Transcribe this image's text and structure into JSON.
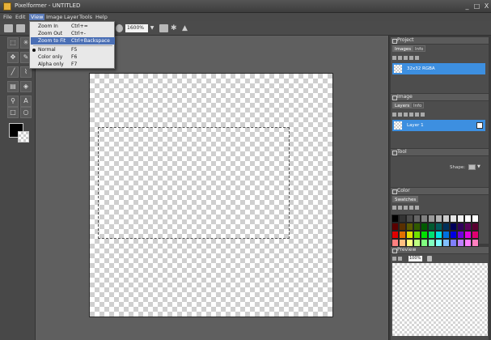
{
  "window": {
    "title": "Pixelformer - UNTITLED",
    "buttons": [
      "_",
      "□",
      "X"
    ]
  },
  "menubar": {
    "items": [
      "File",
      "Edit",
      "View",
      "Image",
      "Layer",
      "Tools",
      "Help"
    ],
    "open": "View"
  },
  "view_menu": {
    "items": [
      {
        "label": "Zoom In",
        "shortcut": "Ctrl+="
      },
      {
        "label": "Zoom Out",
        "shortcut": "Ctrl+-"
      },
      {
        "label": "Zoom to Fit",
        "shortcut": "Ctrl+Backspace",
        "highlighted": true
      },
      {
        "label": "Normal",
        "shortcut": "F5",
        "selected": true
      },
      {
        "label": "Color only",
        "shortcut": "F6"
      },
      {
        "label": "Alpha only",
        "shortcut": "F7"
      }
    ]
  },
  "toolbar": {
    "zoom_value": "1600%"
  },
  "panels": {
    "project": {
      "title": "Project",
      "tabs": [
        "Images",
        "Info"
      ],
      "item": "32x32 RGBA"
    },
    "image": {
      "title": "Image",
      "tabs": [
        "Layers",
        "Info"
      ],
      "item": "Layer 1"
    },
    "tool": {
      "title": "Tool",
      "shape_label": "Shape:"
    },
    "color": {
      "title": "Color",
      "tabs": [
        "Swatches"
      ],
      "swatches": [
        "#000000",
        "#333333",
        "#4d4d4d",
        "#666666",
        "#808080",
        "#999999",
        "#b3b3b3",
        "#cccccc",
        "#e6e6e6",
        "#f2f2f2",
        "#ffffff",
        "#ffffff",
        "#5a0000",
        "#5a3000",
        "#5a5a00",
        "#305a00",
        "#005a00",
        "#005a30",
        "#005a5a",
        "#00305a",
        "#00005a",
        "#30005a",
        "#5a005a",
        "#5a0030",
        "#e00000",
        "#e07000",
        "#e0e000",
        "#70e000",
        "#00e000",
        "#00e070",
        "#00e0e0",
        "#0070e0",
        "#0000e0",
        "#7000e0",
        "#e000e0",
        "#e00070",
        "#ff8080",
        "#ffbf80",
        "#ffff80",
        "#bfff80",
        "#80ff80",
        "#80ffbf",
        "#80ffff",
        "#80bfff",
        "#8080ff",
        "#bf80ff",
        "#ff80ff",
        "#ff80bf"
      ]
    },
    "preview": {
      "title": "Preview",
      "zoom_value": "100%"
    }
  }
}
